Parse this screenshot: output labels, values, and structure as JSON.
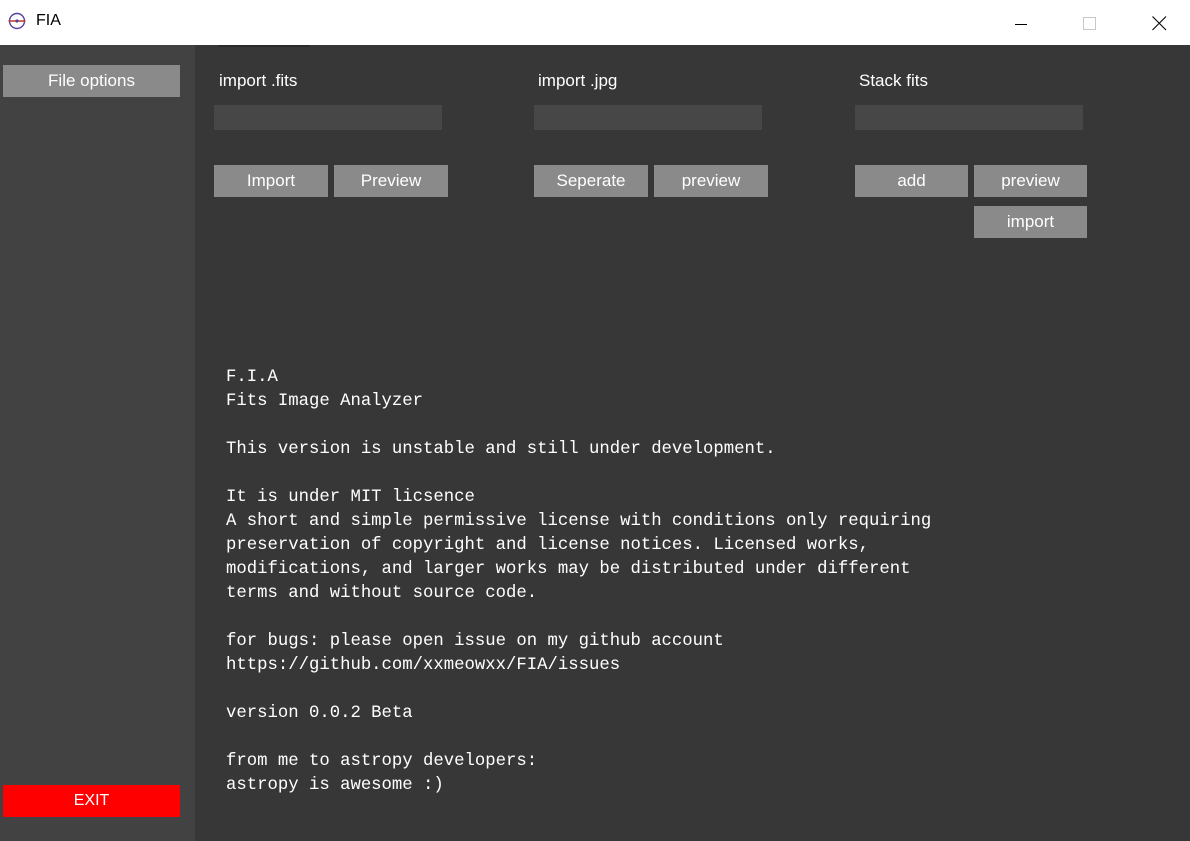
{
  "window": {
    "title": "FIA",
    "controls": [
      "minimize-icon",
      "maximize-icon",
      "close-icon"
    ]
  },
  "sidebar": {
    "file_options_label": "File options",
    "exit_label": "EXIT"
  },
  "sections": {
    "fits": {
      "label": "import .fits",
      "value": "",
      "buttons": [
        "Import",
        "Preview"
      ]
    },
    "jpg": {
      "label": "import .jpg",
      "value": "",
      "buttons": [
        "Seperate",
        "preview"
      ]
    },
    "stack": {
      "label": "Stack fits",
      "value": "",
      "buttons": [
        "add",
        "preview",
        "import"
      ]
    }
  },
  "info": {
    "lines": [
      "F.I.A",
      "Fits Image Analyzer",
      "",
      "This version is unstable and still under development.",
      "",
      "It is under MIT licsence",
      "A short and simple permissive license with conditions only requiring",
      "preservation of copyright and license notices. Licensed works,",
      "modifications, and larger works may be distributed under different",
      "terms and without source code.",
      "",
      "for bugs: please open issue on my github account",
      "https://github.com/xxmeowxx/FIA/issues",
      "",
      "version 0.0.2 Beta",
      "",
      "from me to astropy developers:",
      "astropy is awesome :)"
    ]
  },
  "colors": {
    "main_bg": "#373737",
    "sidebar_bg": "#424242",
    "button_bg": "#8a8a8a",
    "field_bg": "#474747",
    "exit_bg": "#ff0000"
  }
}
